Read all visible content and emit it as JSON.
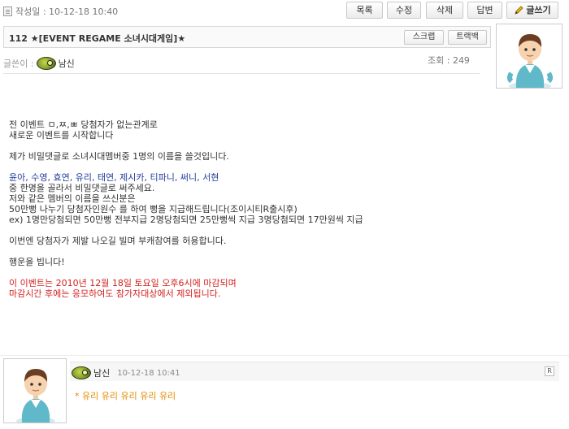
{
  "header": {
    "date_label": "작성일 : 10-12-18 10:40",
    "buttons": {
      "list": "목록",
      "edit": "수정",
      "delete": "삭제",
      "reply": "답변",
      "write": "글쓰기"
    }
  },
  "post": {
    "title": "112 ★[EVENT REGAME 소녀시대게임]★",
    "scrap": "스크랩",
    "trackback": "트랙백",
    "author_prefix": "글쓴이 :",
    "author": "남신",
    "views": "조회 : 249",
    "lines": [
      "전 이벤트 ㅁ,ㅉ,ㅃ 당첨자가 없는관계로",
      "새로운 이벤트를 시작합니다",
      "제가 비밀댓글로 소녀시대멤버중 1명의 이름을 쓸것입니다.",
      "윤아, 수영, 효연, 유리, 태연, 제시카, 티파니, 써니, 서현",
      "중 한명을 골라서 비밀댓글로 써주세요.",
      "저와 같은 멤버의 이름을 쓰신분은",
      "50만뻥 나누기 당첨자인원수 를 하여 뻥을 지급해드립니다(조이시티R출시후)",
      "ex) 1명만당첨되면 50만뻥 전부지급 2명당첨되면 25만뻥씩 지급 3명당첨되면 17만원씩 지급",
      "이번엔 당첨자가 제발 나오길 빌며 부캐참여를 허용합니다.",
      "행운을 빕니다!",
      "이 이벤트는 2010년 12월 18일 토요일 오후6시에 마감되며",
      "마감시간 후에는 응모하여도 참가자대상에서 제외됩니다."
    ]
  },
  "comment": {
    "author": "남신",
    "date": "10-12-18 10:41",
    "reply_btn": "R",
    "text": "* 유리 유리 유리 유리 유리"
  },
  "colors": {
    "highlight_blue": "#1f3c9c",
    "notice_red": "#d42020",
    "comment_orange": "#e48a00"
  }
}
